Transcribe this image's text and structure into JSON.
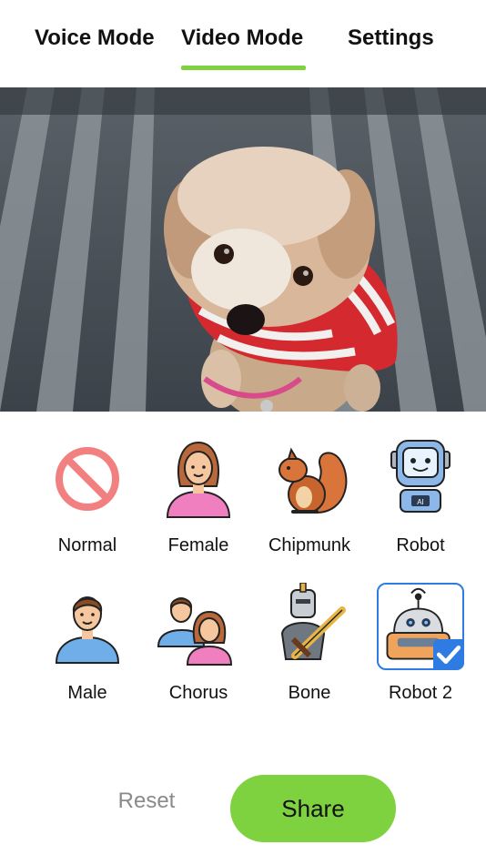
{
  "tabs": [
    {
      "label": "Voice Mode",
      "active": false
    },
    {
      "label": "Video Mode",
      "active": true
    },
    {
      "label": "Settings",
      "active": false
    }
  ],
  "accent_color": "#7ed23f",
  "selection_color": "#2d7be3",
  "effects": [
    {
      "label": "Normal",
      "icon": "no-entry-icon"
    },
    {
      "label": "Female",
      "icon": "woman-avatar-icon"
    },
    {
      "label": "Chipmunk",
      "icon": "squirrel-icon"
    },
    {
      "label": "Robot",
      "icon": "robot-ai-icon"
    },
    {
      "label": "Male",
      "icon": "man-avatar-icon"
    },
    {
      "label": "Chorus",
      "icon": "group-icon"
    },
    {
      "label": "Bone",
      "icon": "knight-icon"
    },
    {
      "label": "Robot 2",
      "icon": "robot-antenna-icon",
      "selected": true
    }
  ],
  "buttons": {
    "reset": "Reset",
    "share": "Share"
  }
}
